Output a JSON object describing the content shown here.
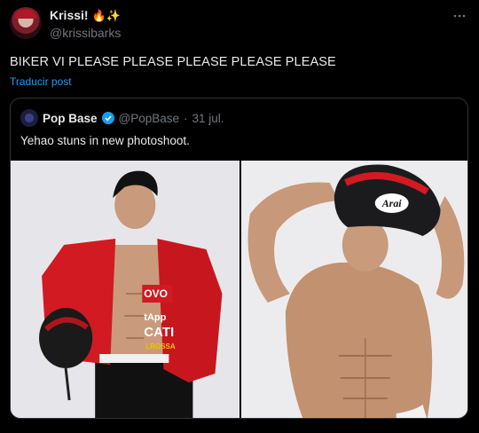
{
  "author": {
    "display_name": "Krissi!",
    "emojis": "🔥✨",
    "handle": "@krissibarks"
  },
  "tweet": {
    "text": "BIKER VI PLEASE PLEASE PLEASE PLEASE PLEASE",
    "translate_label": "Traducir post",
    "more_icon": "more-icon"
  },
  "quote": {
    "display_name": "Pop Base",
    "handle": "@PopBase",
    "separator": "·",
    "date": "31 jul.",
    "text": "Yehao stuns in new photoshoot.",
    "verified_color": "#1d9bf0"
  },
  "jacket": {
    "logo_line1": "OVO",
    "logo_line2": "tApp",
    "logo_line3": "CATI",
    "logo_line4": "LROSSA"
  },
  "helmet": {
    "brand": "Arai"
  },
  "colors": {
    "background": "#000000",
    "text": "#e7e9ea",
    "muted": "#71767b",
    "link": "#1d9bf0",
    "border": "#2f3336",
    "jacket_red": "#d11a22"
  }
}
